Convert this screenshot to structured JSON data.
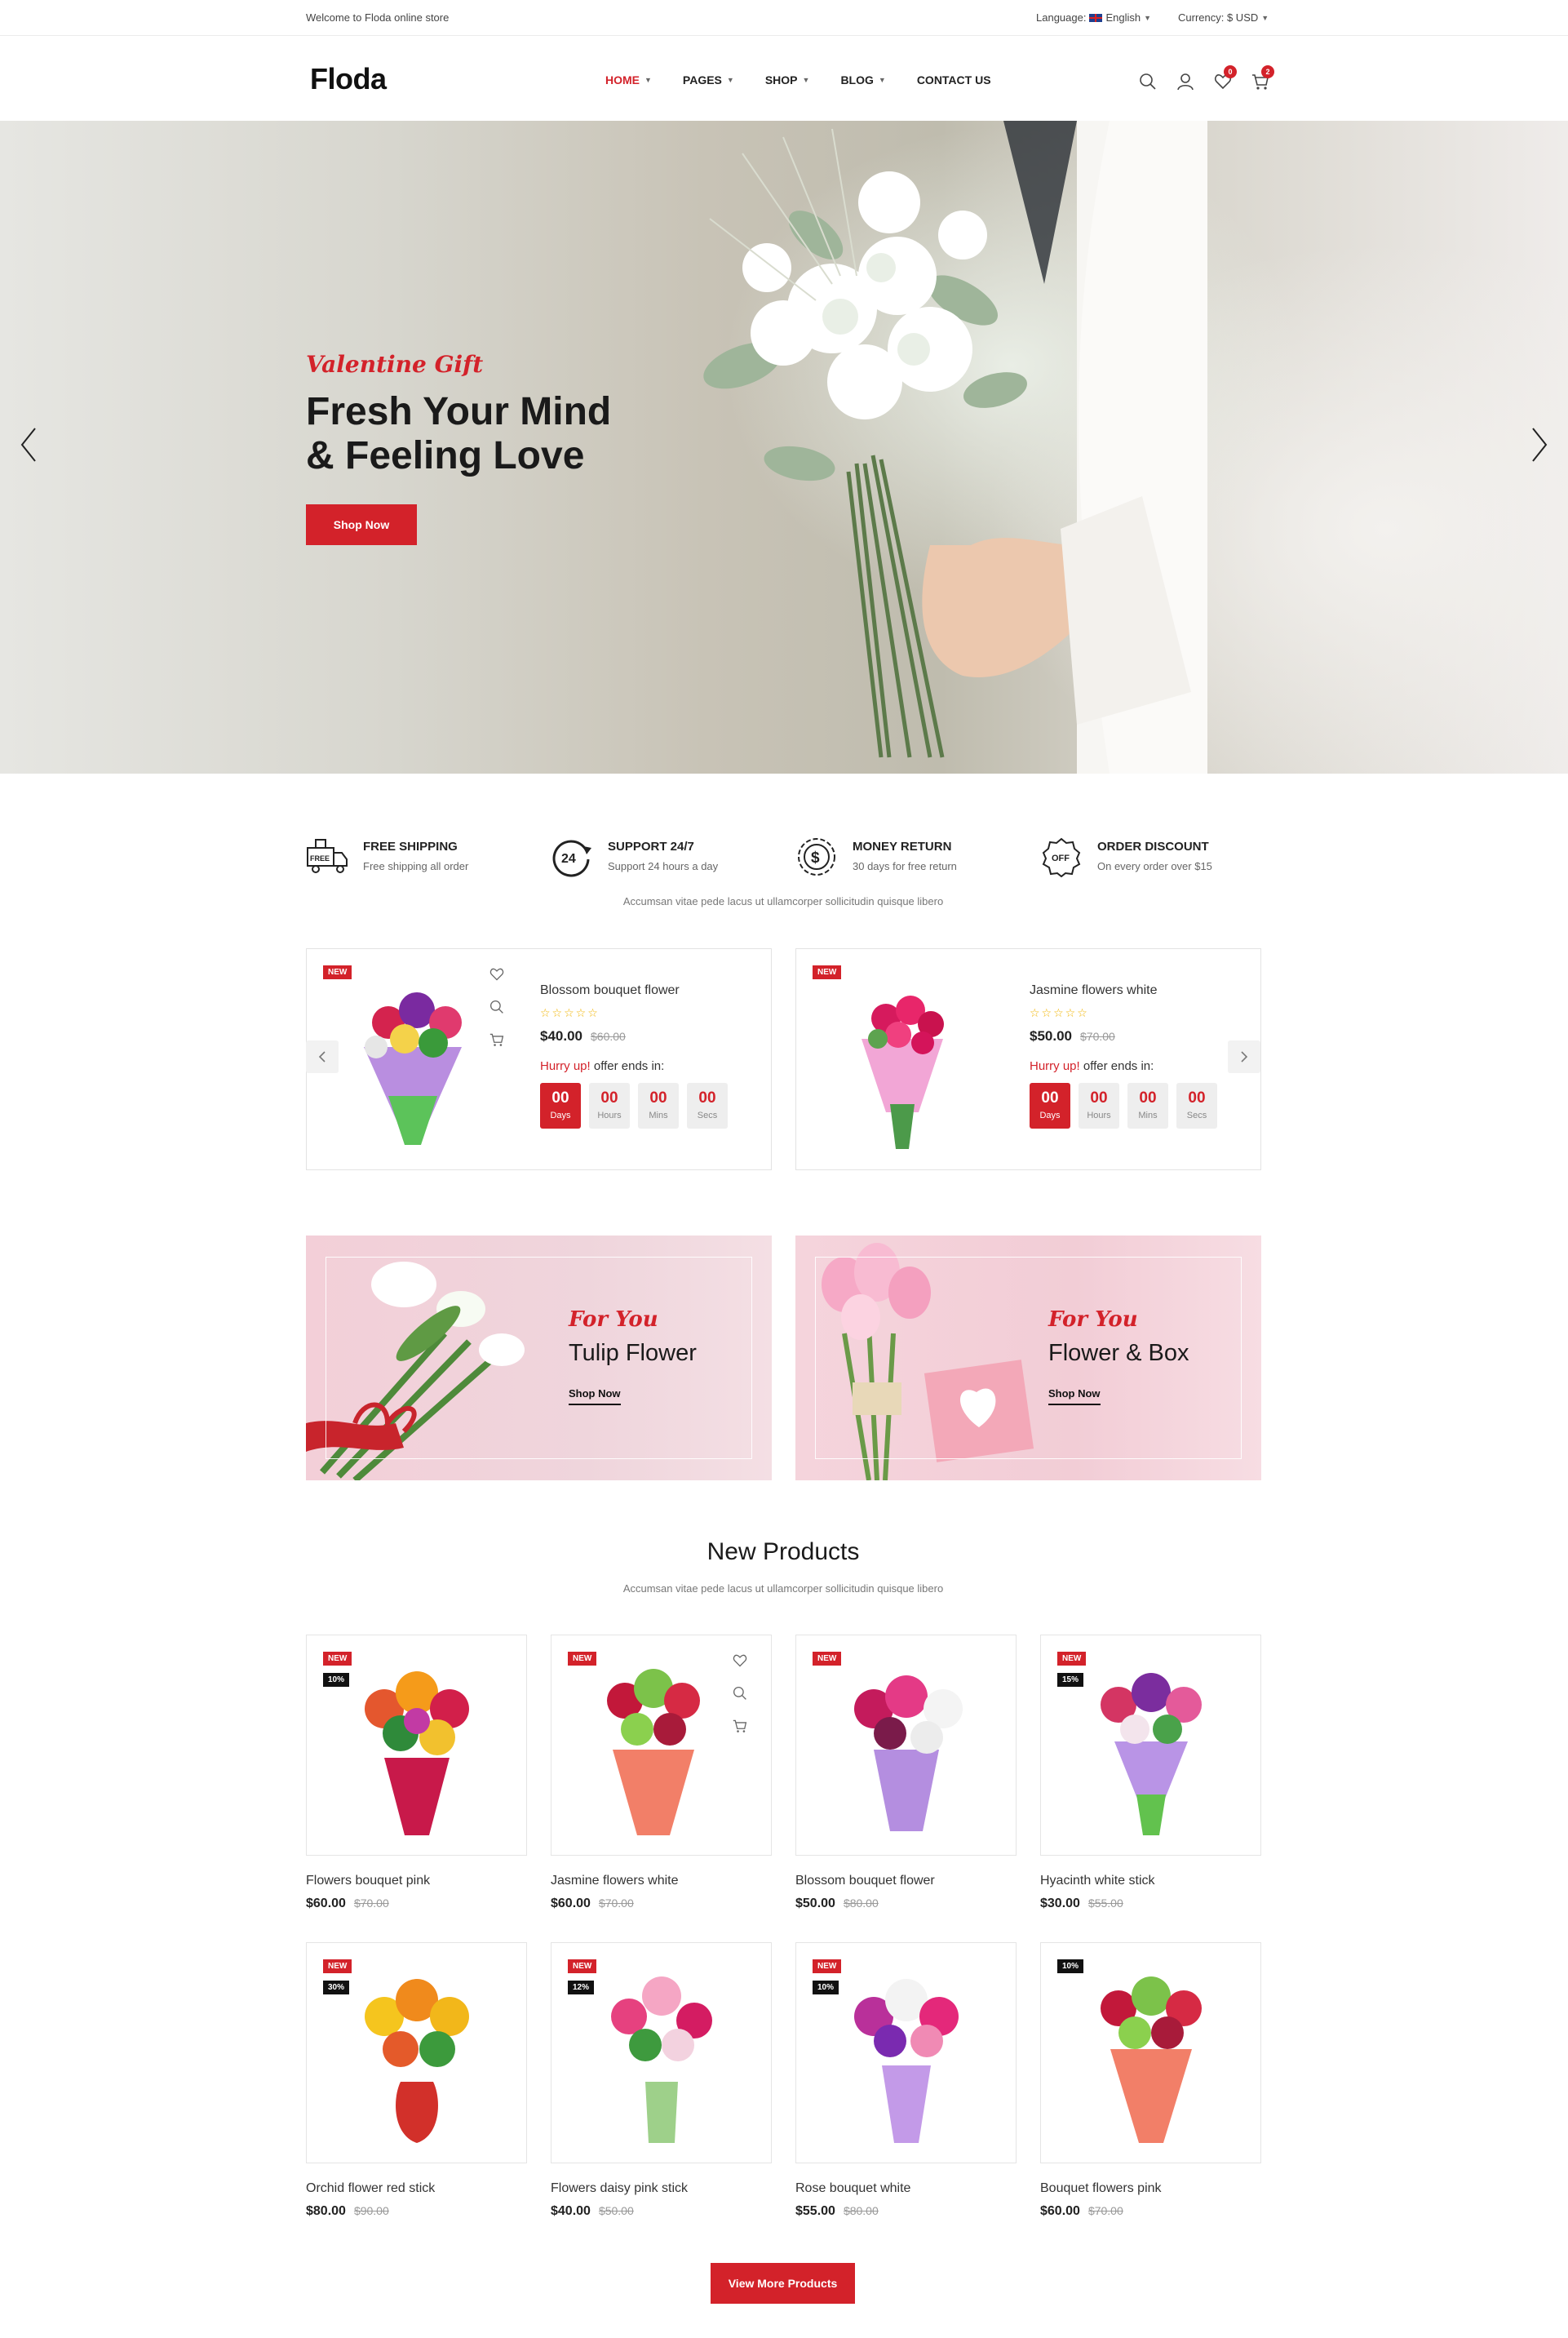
{
  "topbar": {
    "welcome": "Welcome to Floda online store",
    "language_label": "Language:",
    "language_value": "English",
    "currency_label": "Currency: $ USD"
  },
  "header": {
    "logo": "Floda",
    "nav": [
      {
        "label": "HOME"
      },
      {
        "label": "PAGES"
      },
      {
        "label": "SHOP"
      },
      {
        "label": "BLOG"
      },
      {
        "label": "CONTACT US"
      }
    ],
    "wishlist_count": "0",
    "cart_count": "2"
  },
  "hero": {
    "tagline": "Valentine Gift",
    "title_line1": "Fresh Your Mind",
    "title_line2": "& Feeling Love",
    "button": "Shop Now"
  },
  "features": [
    {
      "icon": "free-shipping-truck-icon",
      "title": "FREE SHIPPING",
      "sub": "Free shipping all order"
    },
    {
      "icon": "support-24-icon",
      "title": "SUPPORT 24/7",
      "sub": "Support 24 hours a day"
    },
    {
      "icon": "money-return-icon",
      "title": "MONEY RETURN",
      "sub": "30 days for free return"
    },
    {
      "icon": "discount-off-icon",
      "title": "ORDER DISCOUNT",
      "sub": "On every order over $15"
    }
  ],
  "features_caption": "Accumsan vitae pede lacus ut ullamcorper sollicitudin quisque libero",
  "deals": [
    {
      "tag": "NEW",
      "name": "Blossom bouquet flower",
      "price": "$40.00",
      "old": "$60.00",
      "hurry": "Hurry up!",
      "offer": " offer ends in:",
      "countdown": [
        {
          "n": "00",
          "l": "Days"
        },
        {
          "n": "00",
          "l": "Hours"
        },
        {
          "n": "00",
          "l": "Mins"
        },
        {
          "n": "00",
          "l": "Secs"
        }
      ]
    },
    {
      "tag": "NEW",
      "name": "Jasmine flowers white",
      "price": "$50.00",
      "old": "$70.00",
      "hurry": "Hurry up!",
      "offer": " offer ends in:",
      "countdown": [
        {
          "n": "00",
          "l": "Days"
        },
        {
          "n": "00",
          "l": "Hours"
        },
        {
          "n": "00",
          "l": "Mins"
        },
        {
          "n": "00",
          "l": "Secs"
        }
      ]
    }
  ],
  "banners": [
    {
      "tag": "For You",
      "title": "Tulip Flower",
      "link": "Shop Now"
    },
    {
      "tag": "For You",
      "title": "Flower & Box",
      "link": "Shop Now"
    }
  ],
  "new_products": {
    "title": "New Products",
    "caption": "Accumsan vitae pede lacus ut ullamcorper sollicitudin quisque libero",
    "items": [
      {
        "name": "Flowers bouquet pink",
        "price": "$60.00",
        "old": "$70.00",
        "new": "NEW",
        "pct": "10%"
      },
      {
        "name": "Jasmine flowers white",
        "price": "$60.00",
        "old": "$70.00",
        "new": "NEW",
        "pct": ""
      },
      {
        "name": "Blossom bouquet flower",
        "price": "$50.00",
        "old": "$80.00",
        "new": "NEW",
        "pct": ""
      },
      {
        "name": "Hyacinth white stick",
        "price": "$30.00",
        "old": "$55.00",
        "new": "NEW",
        "pct": "15%"
      },
      {
        "name": "Orchid flower red stick",
        "price": "$80.00",
        "old": "$90.00",
        "new": "NEW",
        "pct": "30%"
      },
      {
        "name": "Flowers daisy pink stick",
        "price": "$40.00",
        "old": "$50.00",
        "new": "NEW",
        "pct": "12%"
      },
      {
        "name": "Rose bouquet white",
        "price": "$55.00",
        "old": "$80.00",
        "new": "NEW",
        "pct": "10%"
      },
      {
        "name": "Bouquet flowers pink",
        "price": "$60.00",
        "old": "$70.00",
        "new": "",
        "pct": "10%"
      }
    ],
    "more_button": "View More Products"
  },
  "colors": {
    "accent": "#d3222a",
    "dark": "#111111",
    "pink_banner": "#f2c9d2"
  }
}
